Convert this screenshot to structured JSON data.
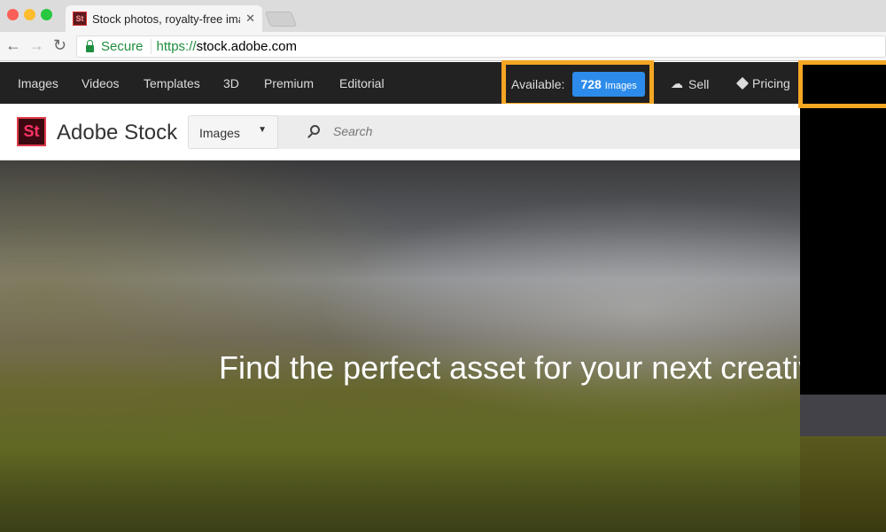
{
  "browser": {
    "tab_title": "Stock photos, royalty-free ima",
    "secure_label": "Secure",
    "url_scheme": "https://",
    "url_host": "stock.adobe.com",
    "favicon_text": "St"
  },
  "topnav": {
    "items": [
      "Images",
      "Videos",
      "Templates",
      "3D",
      "Premium",
      "Editorial"
    ],
    "available_label": "Available:",
    "available_count": "728",
    "available_unit": "Images",
    "sell": "Sell",
    "pricing": "Pricing"
  },
  "header": {
    "logo_text": "St",
    "brand": "Adobe Stock",
    "search_type": "Images",
    "search_placeholder": "Search"
  },
  "hero": {
    "headline": "Find the perfect asset for your next creative"
  },
  "colors": {
    "highlight": "#f5a623",
    "badge": "#2d8ceb",
    "nav_bg": "#222222"
  }
}
